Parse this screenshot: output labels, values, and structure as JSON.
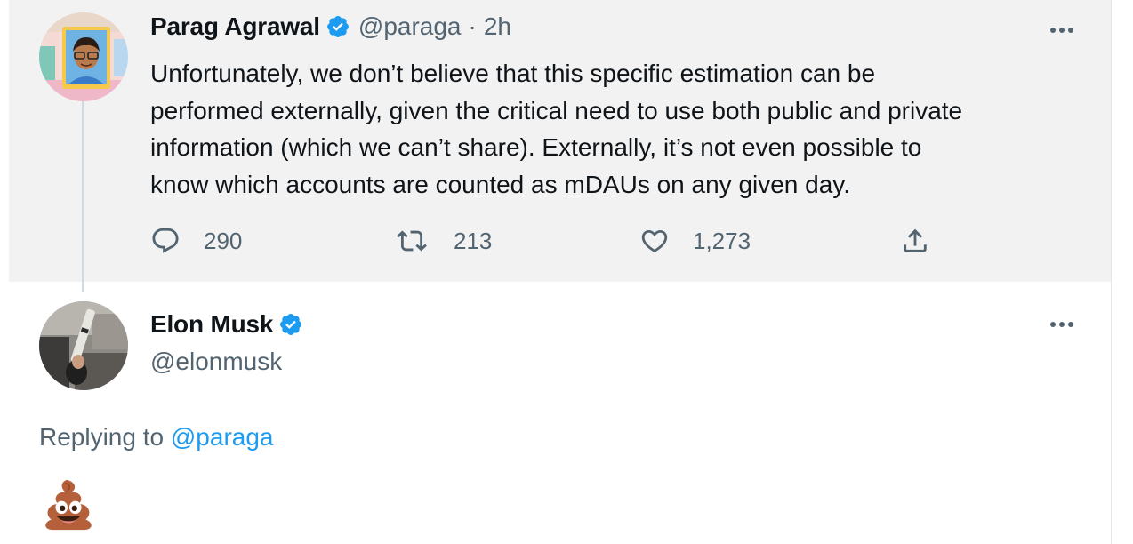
{
  "parent_tweet": {
    "author_name": "Parag Agrawal",
    "handle": "@paraga",
    "separator": "·",
    "time": "2h",
    "text_lines": [
      "Unfortunately, we don’t believe that this specific estimation can be",
      "performed externally, given the critical need to use both public and private",
      "information (which we can’t share). Externally, it’s not even possible to",
      "know which accounts are counted as mDAUs on any given day."
    ],
    "replies": "290",
    "retweets": "213",
    "likes": "1,273"
  },
  "reply_tweet": {
    "author_name": "Elon Musk",
    "handle": "@elonmusk",
    "replying_prefix": "Replying to",
    "replying_handle": "@paraga",
    "emoji_icon": "pile-of-poo-emoji"
  },
  "colors": {
    "accent": "#1d9bf0",
    "text": "#0f1419",
    "muted": "#536471",
    "parent_bg": "#f2f2f2"
  },
  "icons": [
    "verified-badge-icon",
    "more-icon",
    "reply-icon",
    "retweet-icon",
    "like-icon",
    "share-icon"
  ]
}
